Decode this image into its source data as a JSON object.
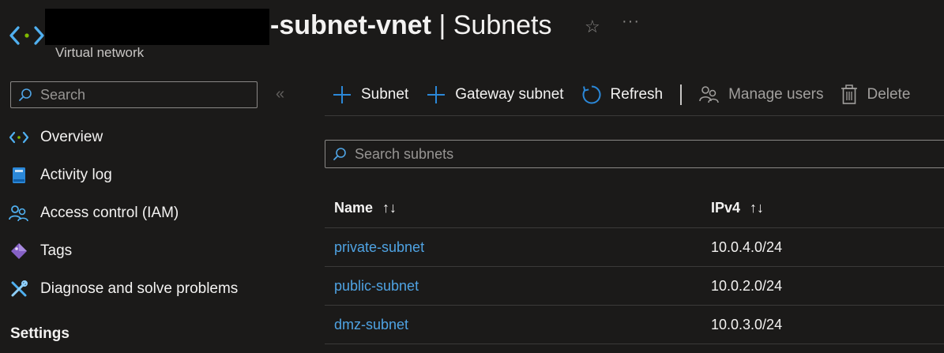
{
  "header": {
    "title_name": "-subnet-vnet",
    "title_separator": " | ",
    "title_section": "Subnets",
    "subtitle": "Virtual network",
    "star_icon": "star-icon",
    "more_icon": "ellipsis-icon",
    "favorite_glyph": "☆",
    "more_glyph": "···"
  },
  "sidebar": {
    "search_placeholder": "Search",
    "collapse_glyph": "«",
    "items": [
      {
        "label": "Overview",
        "icon": "vnet-icon"
      },
      {
        "label": "Activity log",
        "icon": "activity-log-icon"
      },
      {
        "label": "Access control (IAM)",
        "icon": "people-icon"
      },
      {
        "label": "Tags",
        "icon": "tag-icon"
      },
      {
        "label": "Diagnose and solve problems",
        "icon": "wrench-icon"
      }
    ],
    "section_settings": "Settings"
  },
  "toolbar": {
    "add_subnet": "Subnet",
    "add_gateway_subnet": "Gateway subnet",
    "refresh": "Refresh",
    "manage_users": "Manage users",
    "delete": "Delete"
  },
  "grid": {
    "search_placeholder": "Search subnets",
    "columns": [
      {
        "label": "Name",
        "sort": "↑↓"
      },
      {
        "label": "IPv4",
        "sort": "↑↓"
      }
    ],
    "rows": [
      {
        "name": "private-subnet",
        "ipv4": "10.0.4.0/24"
      },
      {
        "name": "public-subnet",
        "ipv4": "10.0.2.0/24"
      },
      {
        "name": "dmz-subnet",
        "ipv4": "10.0.3.0/24"
      }
    ]
  },
  "colors": {
    "background": "#1b1a19",
    "link": "#4fa3e3",
    "accent": "#0078d4"
  }
}
